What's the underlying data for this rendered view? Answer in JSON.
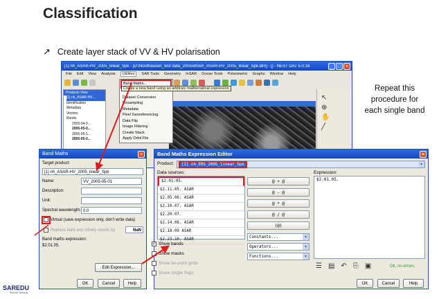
{
  "slide": {
    "title": "Classification",
    "bullet_arrow": "↗",
    "bullet": "Create layer stack of VV & HV polarisation",
    "side_note_lines": [
      "Repeat this",
      "procedure for",
      "each single band"
    ]
  },
  "nest_window": {
    "title": "[1] nh_ASAR-HV_2005_linear_Spk - [D:\\Nordhausen_test data_2005\\dmish_ASAR-HV_2005_linear_Spk.dim] - [] - NEST DAT 5.0.16",
    "menu": [
      "File",
      "Edit",
      "View",
      "Analysis",
      "Utilities",
      "SAR Tools",
      "Geometry",
      "InSAR",
      "Ocean Tools",
      "Polarimetric",
      "Graphs",
      "Window",
      "Help"
    ],
    "active_menu_index": 4,
    "products_view_title": "Products View",
    "tree": [
      "[1] nh_ASAR-HV...",
      "Identification",
      "Metadata",
      "Vectors",
      "Bands",
      "2005-04-2...",
      "2005-05-0...",
      "2005-05-1...",
      "2005-05-0..."
    ],
    "utilities_menu": [
      "Band Maths...",
      "Dataset Conversion",
      "Resampling",
      "Metadata",
      "Pixel Georeferencing",
      "Data Flip",
      "Image Filtering",
      "Create Stack",
      "Apply Orbit File"
    ],
    "tooltip": "Create a new band using an arbitrary mathematical expression"
  },
  "band_maths": {
    "title": "Band Maths",
    "target_product_label": "Target product:",
    "target_product_value": "[1] nh_ASAR-HV_2005_linear_Spk",
    "name_label": "Name:",
    "name_value": "VV_2005-05-01",
    "description_label": "Description:",
    "unit_label": "Unit:",
    "spectral_label": "Spectral wavelength:",
    "spectral_value": "0.0",
    "virtual_label": "Virtual (save expression only, don't write data)",
    "replace_nan_label": "Replace NaN and infinity results by",
    "replace_nan_value": "NaN",
    "expression_label": "Band maths expression:",
    "expression_value": "$2.01.05.",
    "edit_expression_button": "Edit Expression...",
    "ok_button": "OK",
    "cancel_button": "Cancel",
    "help_button": "Help"
  },
  "expression_editor": {
    "title": "Band Maths Expression Editor",
    "product_label": "Product:",
    "product_value": "[2] nh_ERS_2005_linear_Spk",
    "data_sources_label": "Data sources:",
    "data_sources": [
      "$2.01.05.",
      "$2.11.05. ASAR",
      "$2.05.06. ASAR",
      "$2.10.07. ASAR",
      "$2.20.07.",
      "$2.14.08. ASAR",
      "$2.18.09 ASAR",
      "$2.23.10. ASAR"
    ],
    "operators": [
      "@ + @",
      "@ - @",
      "@ * @",
      "@ / @",
      "(@)"
    ],
    "combos": [
      "Constants...",
      "Operators...",
      "Functions..."
    ],
    "show_bands_label": "Show bands",
    "show_masks_label": "Show masks",
    "show_tie_label": "Show tie-point grids",
    "show_flags_label": "Show single flags",
    "expression_label": "Expression:",
    "expression_value": "$2.01.05.",
    "status": "Ok, no errors.",
    "ok_button": "OK",
    "cancel_button": "Cancel",
    "help_button": "Help"
  },
  "logo": {
    "text": "SAREDU",
    "sub": "Remote Sensing"
  },
  "colors": {
    "accent_red": "#e0191b",
    "xp_blue": "#1d4fb8",
    "status_green": "#2e9c2e"
  }
}
